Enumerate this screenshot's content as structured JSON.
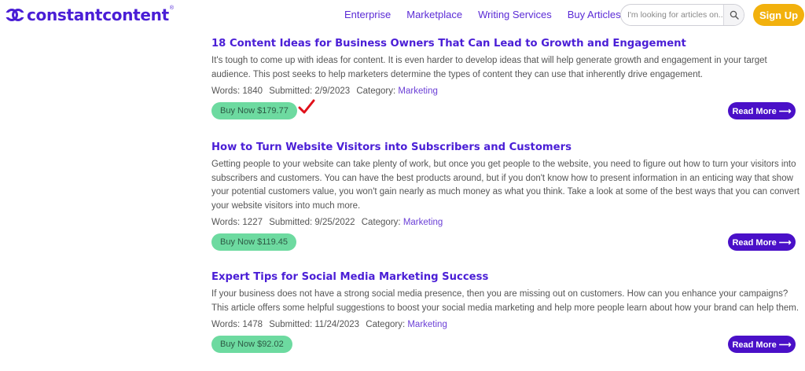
{
  "header": {
    "logo_text": "constantcontent",
    "logo_mark": "®",
    "nav": [
      "Enterprise",
      "Marketplace",
      "Writing Services",
      "Buy Articles"
    ],
    "search_placeholder": "I'm looking for articles on...",
    "signup_label": "Sign Up"
  },
  "articles": [
    {
      "title": "18 Content Ideas for Business Owners That Can Lead to Growth and Engagement",
      "desc": "It's tough to come up with ideas for content. It is even harder to develop ideas that will help generate growth and engagement in your target audience. This post seeks to help marketers determine the types of content they can use that inherently drive engagement.",
      "words": "Words: 1840",
      "submitted": "Submitted: 2/9/2023",
      "category_label": "Category:",
      "category": "Marketing",
      "buy_label": "Buy Now $179.77",
      "read_label": "Read More ⟶"
    },
    {
      "title": "How to Turn Website Visitors into Subscribers and Customers",
      "desc": "Getting people to your website can take plenty of work, but once you get people to the website, you need to figure out how to turn your visitors into subscribers and customers. You can have the best products around, but if you don't know how to present information in an enticing way that show your potential customers value, you won't gain nearly as much money as what you think. Take a look at some of the best ways that you can convert your website visitors into much more.",
      "words": "Words: 1227",
      "submitted": "Submitted: 9/25/2022",
      "category_label": "Category:",
      "category": "Marketing",
      "buy_label": "Buy Now $119.45",
      "read_label": "Read More ⟶"
    },
    {
      "title": "Expert Tips for Social Media Marketing Success",
      "desc": "If your business does not have a strong social media presence, then you are missing out on customers. How can you enhance your campaigns? This article offers some helpful suggestions to boost your social media marketing and help more people learn about how your brand can help them.",
      "words": "Words: 1478",
      "submitted": "Submitted: 11/24/2023",
      "category_label": "Category:",
      "category": "Marketing",
      "buy_label": "Buy Now $92.02",
      "read_label": "Read More ⟶"
    }
  ],
  "colors": {
    "brand": "#4a1ed6",
    "buy": "#6ddaa0",
    "read": "#4a10c8",
    "signup": "#f2b10d",
    "checkmark": "#e0101a"
  },
  "icons": {
    "logo": "linked-circles-logo-icon",
    "search": "search-icon",
    "annotation": "red-checkmark-icon"
  }
}
